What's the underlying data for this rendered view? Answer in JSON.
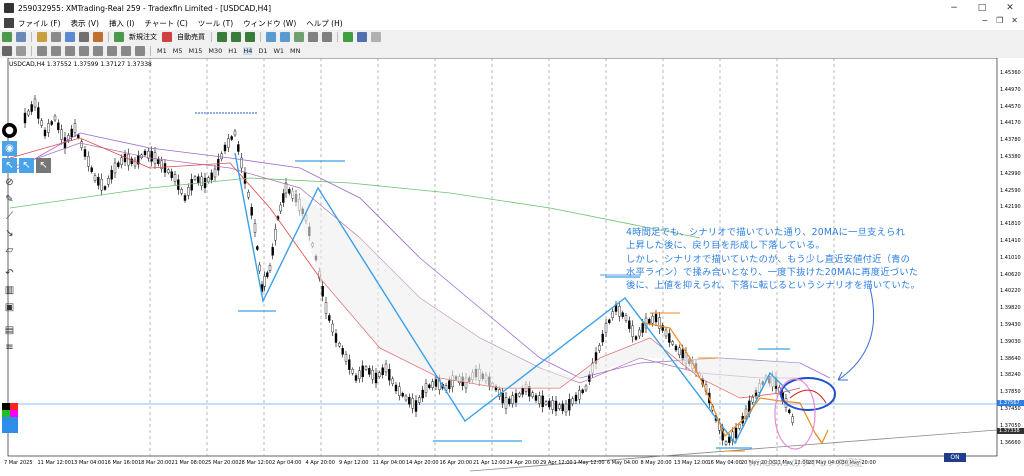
{
  "window": {
    "title": "259032955: XMTrading-Real 259 - Tradexfin Limited - [USDCAD,H4]",
    "controls": [
      "−",
      "□",
      "✕"
    ]
  },
  "menu": {
    "items": [
      "ファイル (F)",
      "表示 (V)",
      "挿入 (I)",
      "チャート (C)",
      "ツール (T)",
      "ウィンドウ (W)",
      "ヘルプ (H)"
    ],
    "mdi_controls": [
      "−",
      "❐",
      "✕"
    ]
  },
  "toolbar": {
    "new_order_label": "新規注文",
    "autotrade_label": "自動売買",
    "timeframes": [
      "M1",
      "M5",
      "M15",
      "M30",
      "H1",
      "H4",
      "D1",
      "W1",
      "MN"
    ]
  },
  "chart": {
    "symbol_label": "USDCAD,H4  1.37552 1.37599 1.37127 1.37338",
    "price_labels": [
      "1.45360",
      "1.44970",
      "1.44570",
      "1.44170",
      "1.43780",
      "1.43380",
      "1.42990",
      "1.42590",
      "1.42190",
      "1.41810",
      "1.41410",
      "1.41010",
      "1.40620",
      "1.40220",
      "1.39820",
      "1.39430",
      "1.39030",
      "1.38640",
      "1.38240",
      "1.37850",
      "1.37450",
      "1.37050",
      "1.36660"
    ],
    "badge_bid": "1.37567",
    "badge_last": "1.37338",
    "time_labels": [
      "7 Mar 2025",
      "11 Mar 12:00",
      "13 Mar 04:00",
      "16 Mar 16:00",
      "18 Mar 20:00",
      "21 Mar 08:00",
      "25 Mar 20:00",
      "28 Mar 12:00",
      "2 Apr 04:00",
      "4 Apr 20:00",
      "9 Apr 12:00",
      "11 Apr 04:00",
      "14 Apr 20:00",
      "16 Apr 20:00",
      "21 Apr 12:00",
      "24 Apr 20:00",
      "29 Apr 12:00",
      "1 May 12:00",
      "6 May 04:00",
      "8 May 20:00",
      "13 May 12:00",
      "16 May 04:00",
      "20 May 20:00",
      "23 May 12:00",
      "28 May 04:00",
      "30 May 20:00"
    ],
    "on_label": "ON",
    "watermark": "Windows のライセンス認証"
  },
  "annotation": {
    "lines": [
      "4時間足でも、シナリオで描いていた通り、20MAに一旦支えられ",
      "上昇した後に、戻り目を形成し下落している。",
      "しかし、シナリオで描いていたのが、もう少し直近安値付近（青の",
      "水平ライン）で揉み合いとなり、一度下抜けた20MAに再度近づいた",
      "後に、上値を抑えられ、下落に転じるというシナリオを描いていた。"
    ]
  },
  "colors": {
    "annotation_text": "#2d7fe3",
    "zigzag": "#3aa0e8",
    "scenario": "#f08a1c",
    "ma20": "#e04848",
    "ma_purple": "#9a6ad0",
    "ma_green": "#6cc26c",
    "highlight_circle": "#1f4fd0",
    "pink_circle": "#e88ad8"
  }
}
